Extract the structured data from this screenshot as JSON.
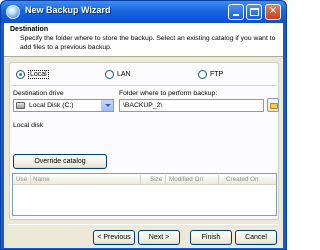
{
  "window": {
    "title": "New Backup Wizard"
  },
  "header": {
    "title": "Destination",
    "description": "Specify the folder where to store the backup. Select an existing catalog if you want to add files to a previous backup."
  },
  "location": {
    "options": [
      {
        "label": "Local",
        "selected": true
      },
      {
        "label": "LAN",
        "selected": false
      },
      {
        "label": "FTP",
        "selected": false
      }
    ]
  },
  "destination": {
    "drive_label": "Destination drive",
    "drive_value": "Local Disk (C:)",
    "folder_label": "Folder where to perform backup:",
    "folder_value": "\\BACKUP_2\\",
    "drive_type": "Local disk"
  },
  "catalog": {
    "override_label": "Override catalog",
    "columns": [
      "Use",
      "Name",
      "Size",
      "Modified On",
      "Created On"
    ],
    "rows": []
  },
  "footer": {
    "prev_label": "< Previous",
    "next_label": "Next >",
    "finish_label": "Finish",
    "cancel_label": "Cancel"
  }
}
